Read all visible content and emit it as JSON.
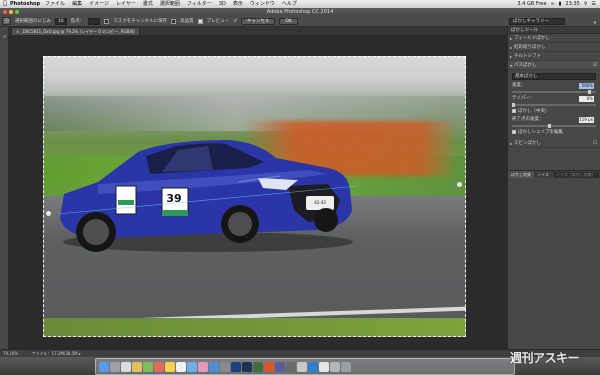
{
  "menubar": {
    "app": "Photoshop",
    "items": [
      "ファイル",
      "編集",
      "イメージ",
      "レイヤー",
      "書式",
      "選択範囲",
      "フィルター",
      "3D",
      "表示",
      "ウィンドウ",
      "ヘルプ"
    ],
    "status": {
      "battery": "3.4 GB Free",
      "time": "23:35"
    }
  },
  "window": {
    "title": "Adobe Photoshop CC 2014"
  },
  "options": {
    "label_brush": "選択範囲のにじみ",
    "brush_size": "16",
    "label_point": "焦点：",
    "label_save_mask": "マスクをチャンネルに保存",
    "label_quality": "高品質",
    "label_preview": "プレビュー",
    "cancel": "キャンセル",
    "ok": "OK",
    "gallery": "ぼかしギャラリー"
  },
  "document": {
    "tab": "_DSC5811_DxO.jpg @ 79.2% (レイヤー 0 のコピー, RGB/8)"
  },
  "panel": {
    "header": "ぼかしツール",
    "items": [
      {
        "label": "フィールドぼかし",
        "open": false
      },
      {
        "label": "虹彩絞りぼかし",
        "open": false
      },
      {
        "label": "チルトシフト",
        "open": false
      },
      {
        "label": "パスぼかし",
        "open": true
      },
      {
        "label": "スピンぼかし",
        "open": false
      }
    ],
    "path_blur": {
      "mode": "基本ぼかし",
      "speed_label": "速度：",
      "speed_value": "500%",
      "taper_label": "テイパー：",
      "taper_value": "0%",
      "centered_label": "ぼかし（中央）",
      "end_speed_label": "終了点の速度：",
      "end_speed_value": "119 px",
      "edit_shapes_label": "ぼかしシェイプを編集"
    },
    "tabs": [
      "ぼかし効果",
      "ノイズ"
    ],
    "placeholder": "ノイズ（ぼかし効果）"
  },
  "car": {
    "number": "39",
    "plate_text": "42-43"
  },
  "status": {
    "zoom": "79.16%",
    "doc": "ファイル：17.2M/38.5M"
  },
  "watermark": "週刊アスキー"
}
